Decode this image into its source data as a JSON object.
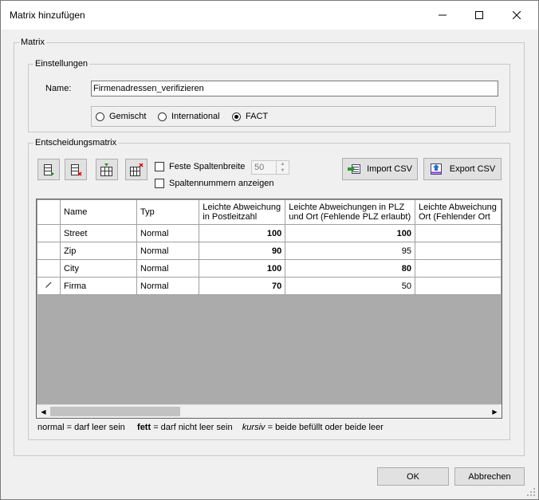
{
  "window": {
    "title": "Matrix hinzufügen",
    "minimize_label": "",
    "maximize_label": "",
    "close_label": ""
  },
  "matrix_group": {
    "legend": "Matrix"
  },
  "settings": {
    "legend": "Einstellungen",
    "name_label": "Name:",
    "name_value": "Firmenadressen_verifizieren",
    "radios": [
      {
        "label": "Gemischt",
        "checked": false
      },
      {
        "label": "International",
        "checked": false
      },
      {
        "label": "FACT",
        "checked": true
      }
    ]
  },
  "decision_matrix": {
    "legend": "Entscheidungsmatrix",
    "fixed_width_label": "Feste Spaltenbreite",
    "fixed_width_value": "50",
    "column_numbers_label": "Spaltennummern anzeigen",
    "import_label": "Import CSV",
    "export_label": "Export CSV",
    "columns": [
      "Name",
      "Typ",
      "Leichte Abweichung in Postleitzahl",
      "Leichte Abweichungen in PLZ und Ort (Fehlende PLZ erlaubt)",
      "Leichte Abweichung Ort (Fehlender Ort"
    ],
    "rows": [
      {
        "name": "Street",
        "typ": "Normal",
        "c1": "100",
        "c2": "100",
        "c3": ""
      },
      {
        "name": "Zip",
        "typ": "Normal",
        "c1": "90",
        "c2": "95",
        "c3": ""
      },
      {
        "name": "City",
        "typ": "Normal",
        "c1": "100",
        "c2": "80",
        "c3": ""
      },
      {
        "name": "Firma",
        "typ": "Normal",
        "c1": "70",
        "c2": "50",
        "c3": ""
      }
    ],
    "legend_normal": "normal",
    "legend_normal_desc": " = darf leer sein",
    "legend_bold": "fett",
    "legend_bold_desc": " = darf nicht leer sein",
    "legend_italic": "kursiv",
    "legend_italic_desc": " = beide befüllt oder beide leer"
  },
  "footer": {
    "ok_label": "OK",
    "cancel_label": "Abbrechen"
  }
}
